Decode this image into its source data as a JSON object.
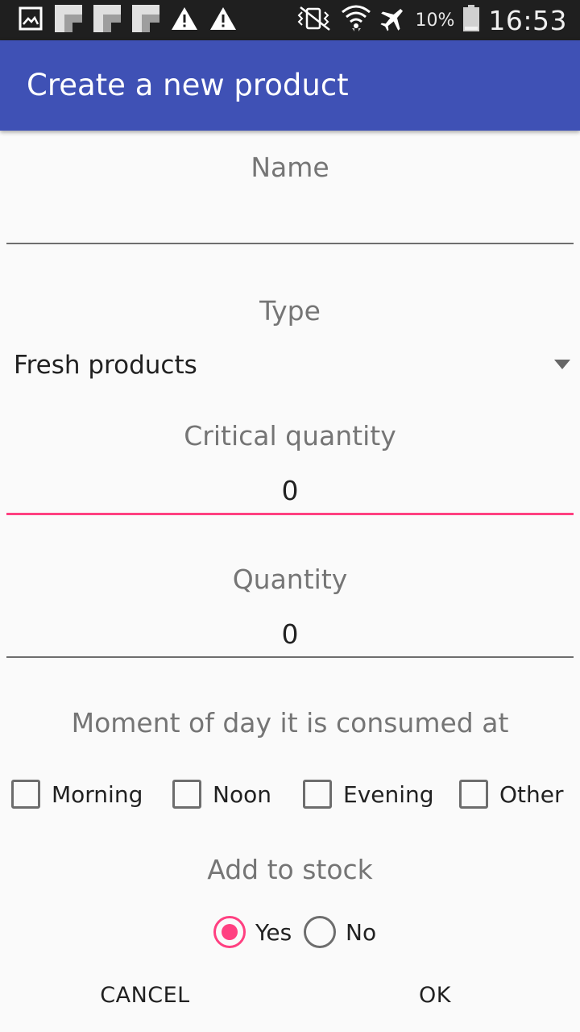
{
  "status_bar": {
    "left_icons": [
      "gallery-icon",
      "notification-block-icon",
      "notification-block-icon",
      "notification-block-icon",
      "warning-icon",
      "warning-icon"
    ],
    "right_icons": [
      "vibrate-icon",
      "wifi-icon",
      "airplane-mode-icon",
      "battery-icon"
    ],
    "battery_percent": "10%",
    "time": "16:53"
  },
  "app_bar": {
    "title": "Create a new product"
  },
  "form": {
    "name": {
      "label": "Name",
      "value": ""
    },
    "type": {
      "label": "Type",
      "selected": "Fresh products"
    },
    "critical_quantity": {
      "label": "Critical quantity",
      "value": "0"
    },
    "quantity": {
      "label": "Quantity",
      "value": "0"
    },
    "moment": {
      "label": "Moment of day it is consumed at",
      "options": [
        {
          "label": "Morning",
          "checked": false
        },
        {
          "label": "Noon",
          "checked": false
        },
        {
          "label": "Evening",
          "checked": false
        },
        {
          "label": "Other",
          "checked": false
        }
      ]
    },
    "add_to_stock": {
      "label": "Add to stock",
      "options": [
        {
          "label": "Yes",
          "selected": true
        },
        {
          "label": "No",
          "selected": false
        }
      ]
    }
  },
  "buttons": {
    "cancel": "CANCEL",
    "ok": "OK"
  },
  "colors": {
    "app_bar": "#3f51b5",
    "accent": "#ff4081",
    "status_bar": "#1f1f1f"
  }
}
